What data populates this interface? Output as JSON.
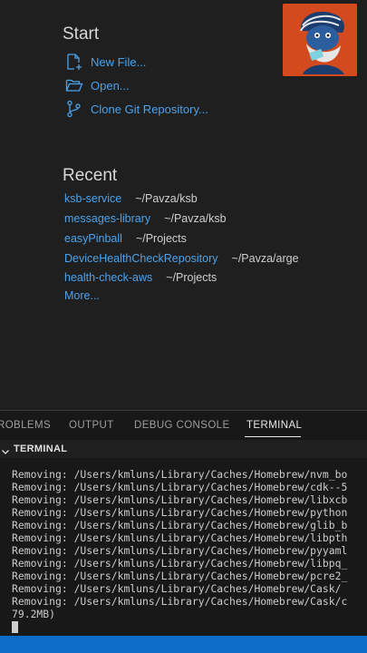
{
  "welcome": {
    "start_title": "Start",
    "actions": [
      {
        "label": "New File...",
        "icon": "new-file-icon"
      },
      {
        "label": "Open...",
        "icon": "folder-open-icon"
      },
      {
        "label": "Clone Git Repository...",
        "icon": "git-branch-icon"
      }
    ],
    "recent_title": "Recent",
    "recent": [
      {
        "name": "ksb-service",
        "path": "~/Pavza/ksb"
      },
      {
        "name": "messages-library",
        "path": "~/Pavza/ksb"
      },
      {
        "name": "easyPinball",
        "path": "~/Projects"
      },
      {
        "name": "DeviceHealthCheckRepository",
        "path": "~/Pavza/arge"
      },
      {
        "name": "health-check-aws",
        "path": "~/Projects"
      }
    ],
    "more_label": "More..."
  },
  "panel": {
    "tabs": [
      "ROBLEMS",
      "OUTPUT",
      "DEBUG CONSOLE",
      "TERMINAL"
    ],
    "active_tab": "TERMINAL",
    "terminal_header": "TERMINAL",
    "terminal_lines": [
      "Removing: /Users/kmluns/Library/Caches/Homebrew/nvm_bo",
      "Removing: /Users/kmluns/Library/Caches/Homebrew/cdk--5",
      "Removing: /Users/kmluns/Library/Caches/Homebrew/libxcb",
      "Removing: /Users/kmluns/Library/Caches/Homebrew/python",
      "Removing: /Users/kmluns/Library/Caches/Homebrew/glib_b",
      "Removing: /Users/kmluns/Library/Caches/Homebrew/libpth",
      "Removing: /Users/kmluns/Library/Caches/Homebrew/pyyaml",
      "Removing: /Users/kmluns/Library/Caches/Homebrew/libpq_",
      "Removing: /Users/kmluns/Library/Caches/Homebrew/pcre2_",
      "Removing: /Users/kmluns/Library/Caches/Homebrew/Cask/",
      "Removing: /Users/kmluns/Library/Caches/Homebrew/Cask/c",
      "79.2MB)"
    ]
  },
  "colors": {
    "link": "#4aa3ec",
    "background": "#1f1f1f",
    "panel": "#181818",
    "statusbar": "#0e6dc7",
    "avatar_bg": "#d24a1d"
  }
}
